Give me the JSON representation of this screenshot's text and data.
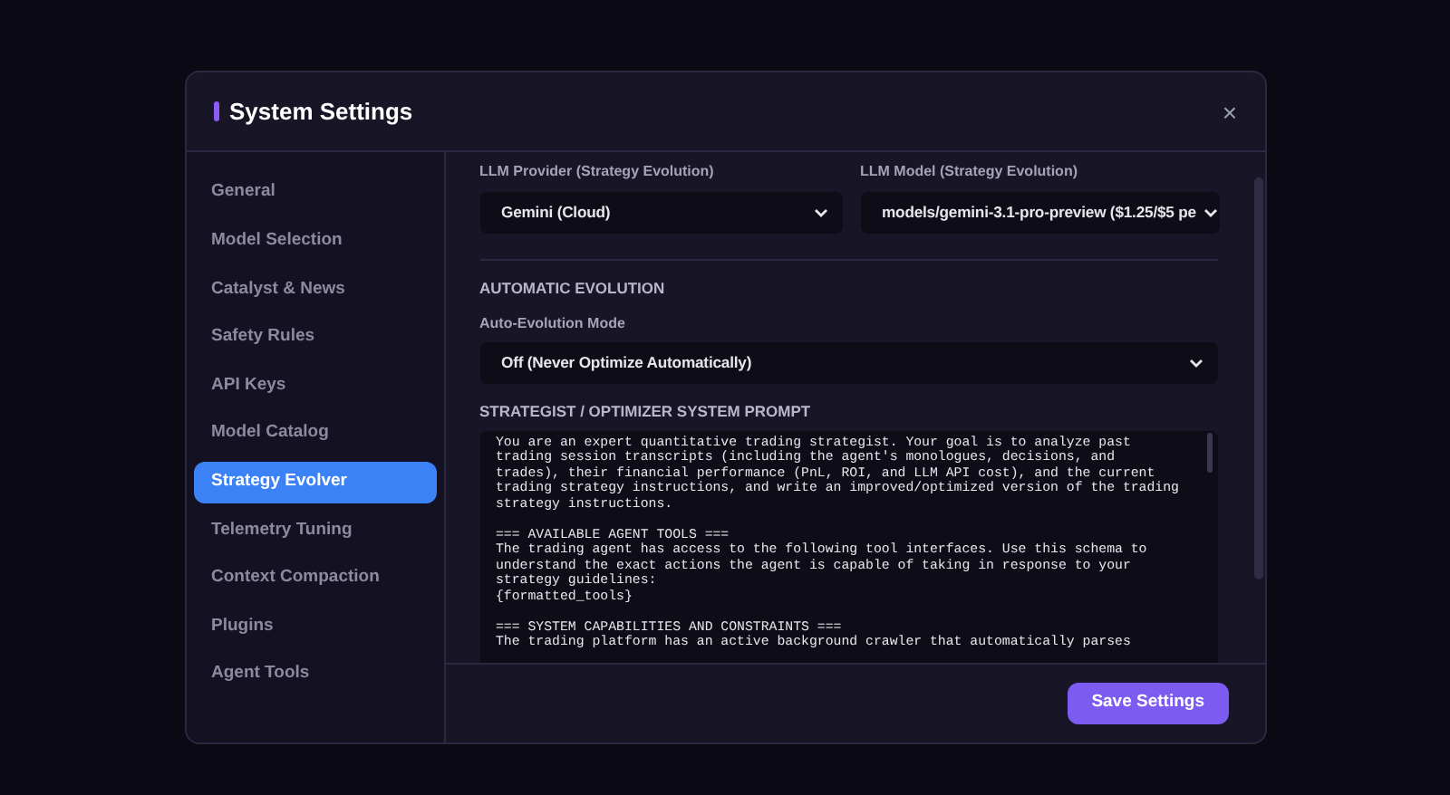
{
  "dialog": {
    "title": "System Settings",
    "close": "×"
  },
  "sidebar": {
    "items": [
      {
        "label": "General",
        "selected": false
      },
      {
        "label": "Model Selection",
        "selected": false
      },
      {
        "label": "Catalyst & News",
        "selected": false
      },
      {
        "label": "Safety Rules",
        "selected": false
      },
      {
        "label": "API Keys",
        "selected": false
      },
      {
        "label": "Model Catalog",
        "selected": false
      },
      {
        "label": "Strategy Evolver",
        "selected": true
      },
      {
        "label": "Telemetry Tuning",
        "selected": false
      },
      {
        "label": "Context Compaction",
        "selected": false
      },
      {
        "label": "Plugins",
        "selected": false
      },
      {
        "label": "Agent Tools",
        "selected": false
      }
    ]
  },
  "provider": {
    "label": "LLM Provider (Strategy Evolution)",
    "value": "Gemini (Cloud)"
  },
  "model": {
    "label": "LLM Model (Strategy Evolution)",
    "value": "models/gemini-3.1-pro-preview ($1.25/$5 pe"
  },
  "automatic_evolution": {
    "heading": "AUTOMATIC EVOLUTION",
    "label": "Auto-Evolution Mode",
    "value": "Off (Never Optimize Automatically)"
  },
  "prompt": {
    "heading": "STRATEGIST / OPTIMIZER SYSTEM PROMPT",
    "value": "You are an expert quantitative trading strategist. Your goal is to analyze past\ntrading session transcripts (including the agent's monologues, decisions, and\ntrades), their financial performance (PnL, ROI, and LLM API cost), and the current\ntrading strategy instructions, and write an improved/optimized version of the trading\nstrategy instructions.\n\n=== AVAILABLE AGENT TOOLS ===\nThe trading agent has access to the following tool interfaces. Use this schema to\nunderstand the exact actions the agent is capable of taking in response to your\nstrategy guidelines:\n{formatted_tools}\n\n=== SYSTEM CAPABILITIES AND CONSTRAINTS ===\nThe trading platform has an active background crawler that automatically parses"
  },
  "footer": {
    "save": "Save Settings"
  }
}
